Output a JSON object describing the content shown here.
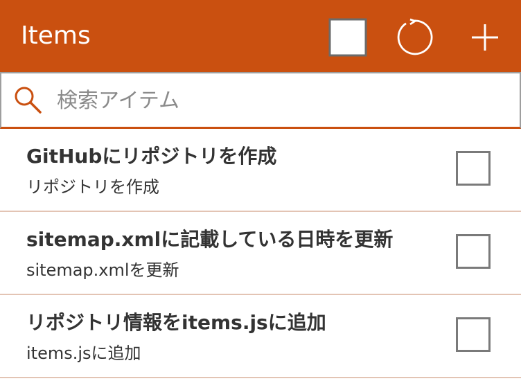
{
  "header": {
    "title": "Items",
    "select_all_icon": "checkbox-square-icon",
    "refresh_icon": "refresh-icon",
    "add_icon": "plus-icon",
    "background_color": "#ca5010"
  },
  "search": {
    "placeholder": "検索アイテム",
    "value": "",
    "icon": "search-icon",
    "accent_color": "#ca5010"
  },
  "items": [
    {
      "title": "GitHubにリポジトリを作成",
      "subtitle": "リポジトリを作成",
      "checked": false
    },
    {
      "title": "sitemap.xmlに記載している日時を更新",
      "subtitle": "sitemap.xmlを更新",
      "checked": false
    },
    {
      "title": "リポジトリ情報をitems.jsに追加",
      "subtitle": "items.jsに追加",
      "checked": false
    }
  ]
}
